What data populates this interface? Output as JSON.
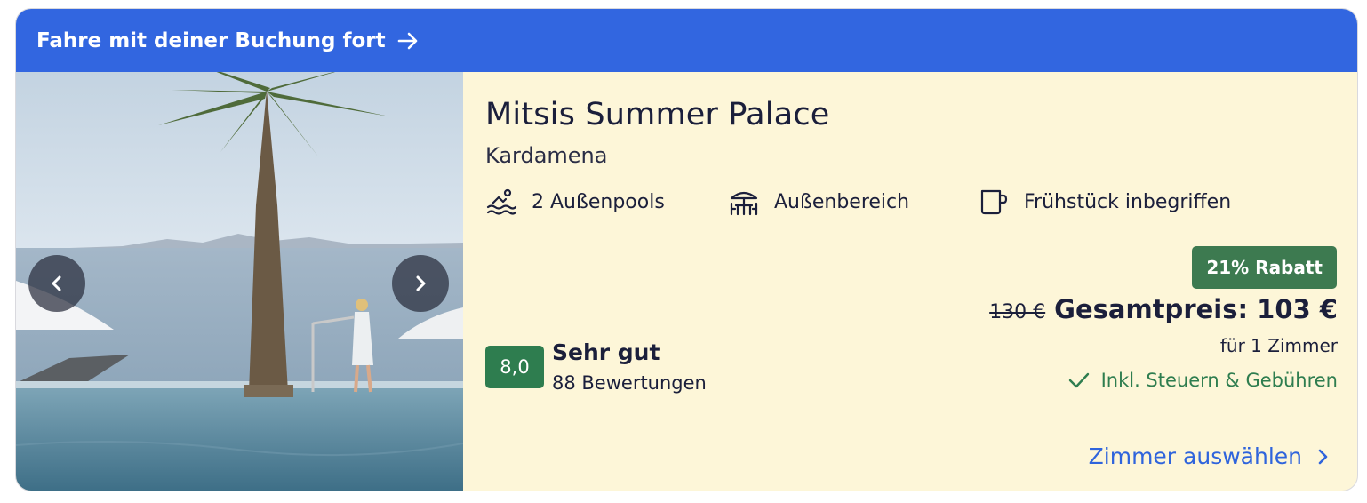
{
  "banner": {
    "label": "Fahre mit deiner Buchung fort",
    "icon": "arrow-right-icon"
  },
  "hotel": {
    "name": "Mitsis Summer Palace",
    "location": "Kardamena",
    "amenities": [
      {
        "icon": "pool-icon",
        "label": "2 Außenpools"
      },
      {
        "icon": "patio-icon",
        "label": "Außenbereich"
      },
      {
        "icon": "coffee-cup-icon",
        "label": "Frühstück inbegriffen"
      }
    ]
  },
  "rating": {
    "score": "8,0",
    "label": "Sehr gut",
    "reviews": "88 Bewertungen"
  },
  "pricing": {
    "discount_badge": "21% Rabatt",
    "original_price": "130 €",
    "total_price": "Gesamtpreis: 103 €",
    "per_room": "für 1 Zimmer",
    "taxes_note": "Inkl. Steuern & Gebühren"
  },
  "cta": {
    "label": "Zimmer auswählen"
  },
  "colors": {
    "banner_bg": "#3266e0",
    "card_bg": "#fdf6d8",
    "rating_badge": "#2e7d4f",
    "discount_badge": "#3d7a50",
    "link": "#2f64dc",
    "success_text": "#2e7d4f"
  }
}
